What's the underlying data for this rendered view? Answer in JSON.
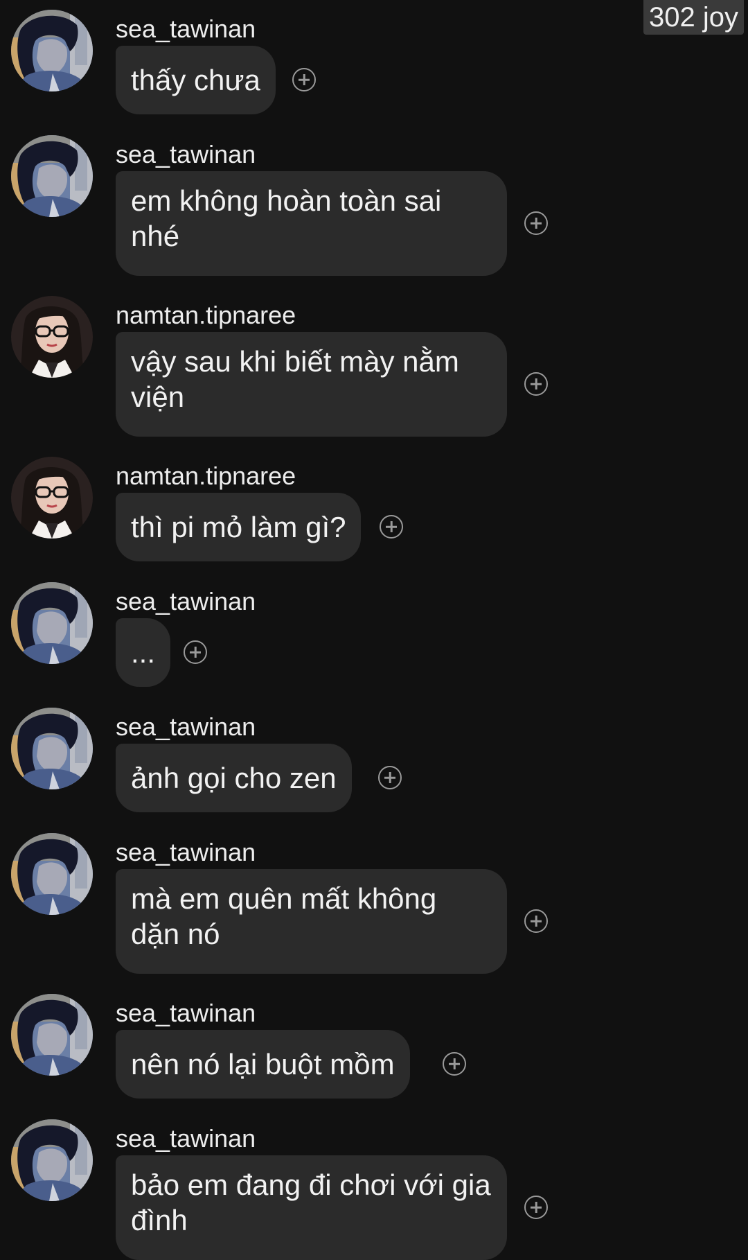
{
  "badge": {
    "text": "302 joy"
  },
  "messages": [
    {
      "user": "sea_tawinan",
      "text": "thấy chưa",
      "avatar": "sea-avatar"
    },
    {
      "user": "sea_tawinan",
      "text": "em không hoàn toàn sai nhé",
      "avatar": "sea-avatar"
    },
    {
      "user": "namtan.tipnaree",
      "text": "vậy sau khi biết mày nằm viện",
      "avatar": "namtan-avatar"
    },
    {
      "user": "namtan.tipnaree",
      "text": "thì pi mỏ làm gì?",
      "avatar": "namtan-avatar"
    },
    {
      "user": "sea_tawinan",
      "text": "...",
      "avatar": "sea-avatar"
    },
    {
      "user": "sea_tawinan",
      "text": "ảnh gọi cho zen",
      "avatar": "sea-avatar"
    },
    {
      "user": "sea_tawinan",
      "text": "mà em quên mất không dặn nó",
      "avatar": "sea-avatar"
    },
    {
      "user": "sea_tawinan",
      "text": "nên nó lại buột mồm",
      "avatar": "sea-avatar"
    },
    {
      "user": "sea_tawinan",
      "text": "bảo em đang đi chơi với gia đình",
      "avatar": "sea-avatar"
    }
  ],
  "colors": {
    "background": "#111111",
    "bubble": "#2b2b2b",
    "text": "#f2f2f2",
    "icon": "#9a9a9a"
  },
  "icons": {
    "react": "add-reaction-icon"
  }
}
